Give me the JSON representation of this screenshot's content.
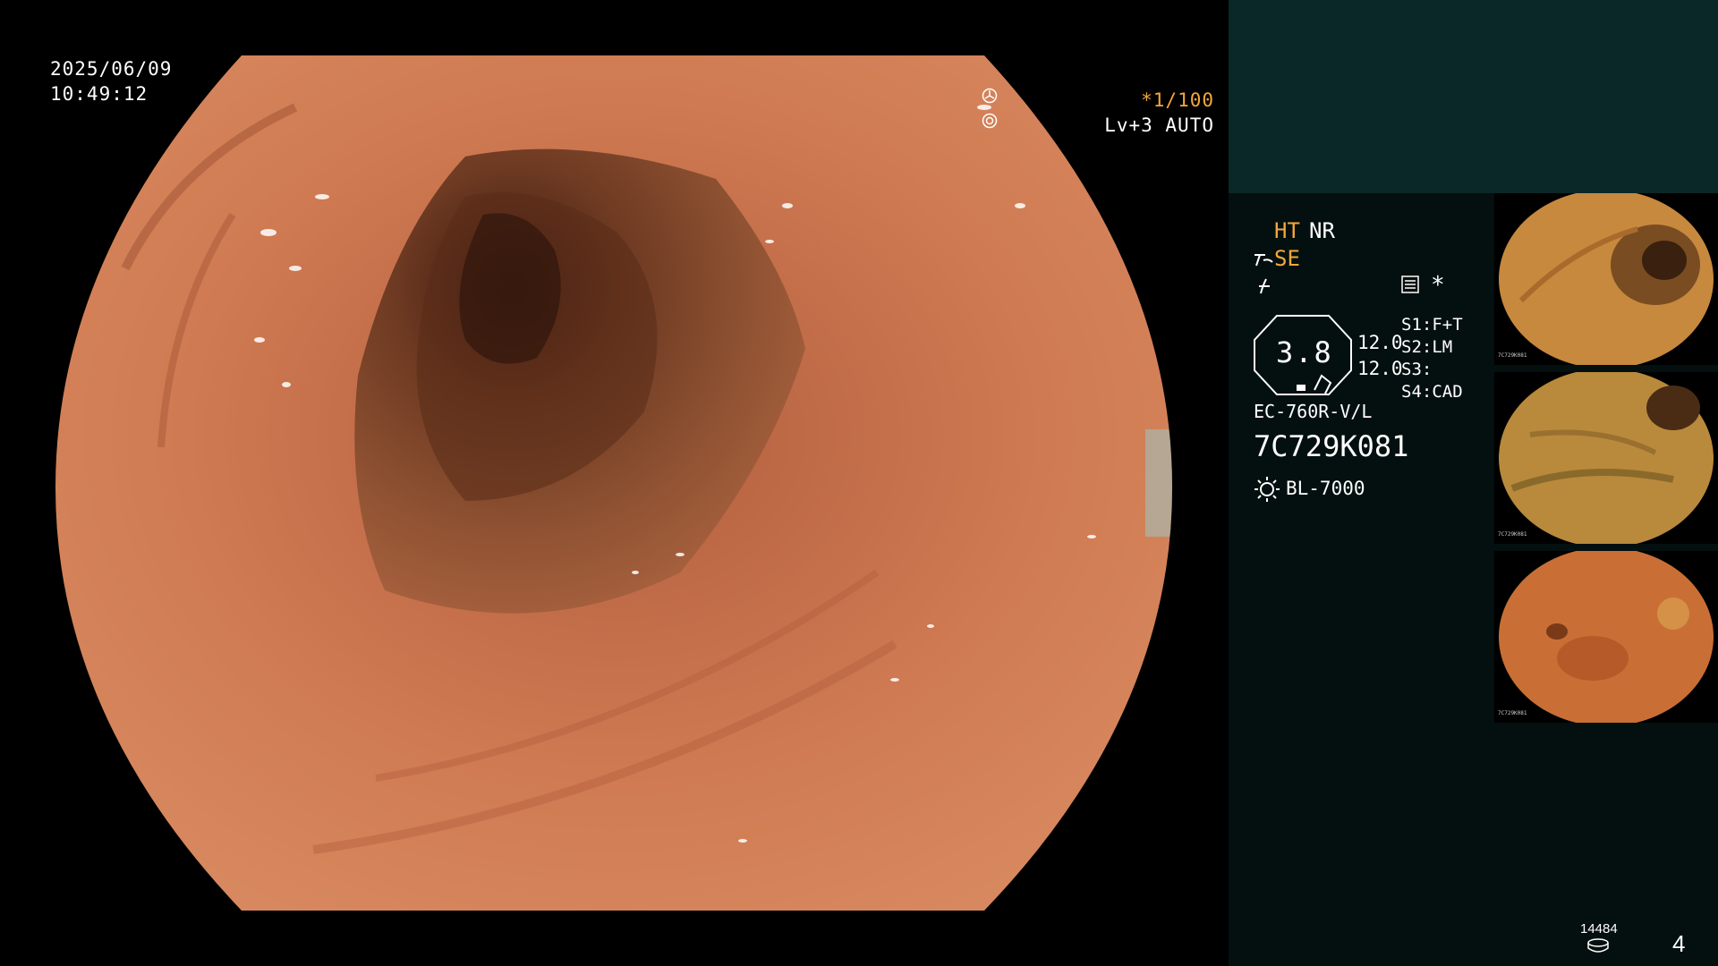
{
  "overlay": {
    "date": "2025/06/09",
    "time": "10:49:12",
    "shutter": "*1/100",
    "level": "Lv+3 AUTO"
  },
  "panel": {
    "ht": "HT",
    "nr": "NR",
    "se": "SE",
    "zoom_value": "3.8",
    "gain_1": "12.0",
    "gain_2": "12.0",
    "s1": "S1:F+T",
    "s2": "S2:LM",
    "s3": "S3:",
    "s4": "S4:CAD",
    "asterisk": "*",
    "scope_model": "EC-760R-V/L",
    "serial": "7C729K081",
    "light_source": "BL-7000",
    "storage_count": "14484",
    "page_number": "4"
  },
  "thumbnails": [
    {
      "label": "7C729K081"
    },
    {
      "label": "7C729K081"
    },
    {
      "label": "7C729K081"
    }
  ],
  "icons": [
    "fan-icon",
    "iris-icon",
    "enhance-icon",
    "structure-icon",
    "memo-icon",
    "lamp-icon",
    "disk-icon"
  ],
  "colors": {
    "accent_orange": "#f4a73a",
    "panel_teal": "#0a2827",
    "panel_dark": "#04100f",
    "mucosa": "#c9714c"
  }
}
